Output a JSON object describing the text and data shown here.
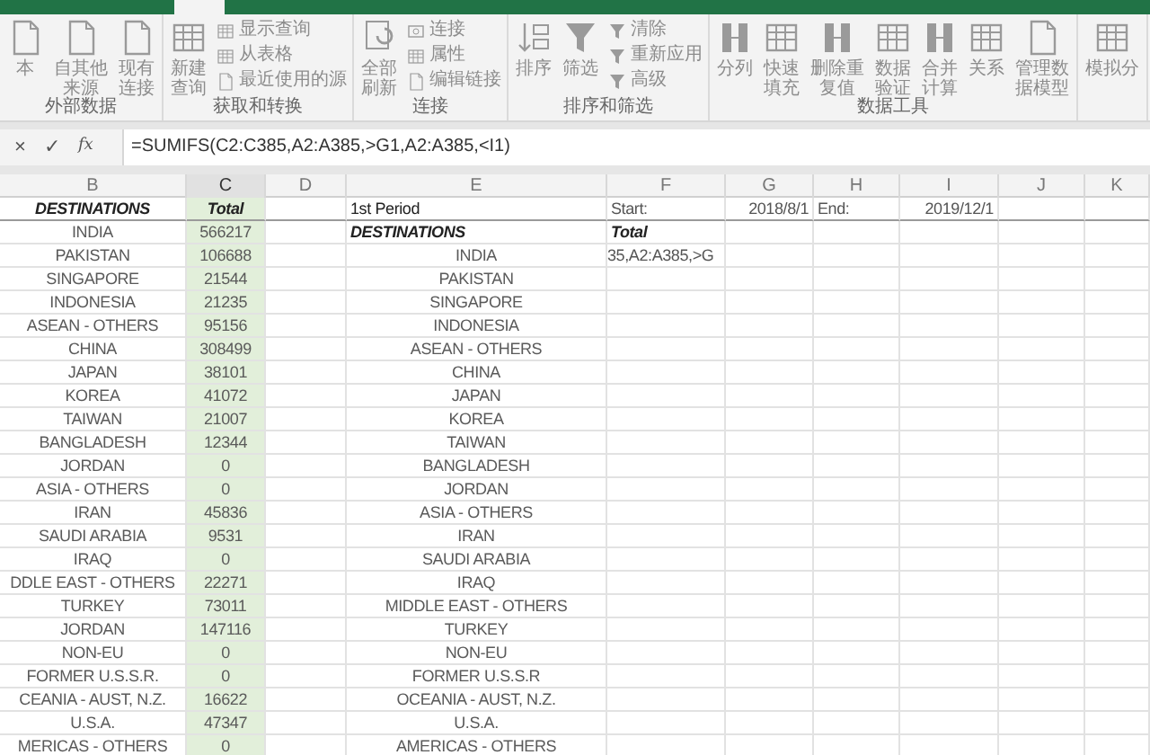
{
  "ribbon": {
    "groups": [
      {
        "label": "外部数据",
        "buttons": [
          {
            "label": "本",
            "kind": "large"
          },
          {
            "label": "自其他来源",
            "kind": "large"
          },
          {
            "label": "现有连接",
            "kind": "large"
          }
        ]
      },
      {
        "label": "获取和转换",
        "buttons": [
          {
            "label": "新建查询",
            "kind": "large"
          },
          {
            "label": "显示查询",
            "kind": "small"
          },
          {
            "label": "从表格",
            "kind": "small"
          },
          {
            "label": "最近使用的源",
            "kind": "small"
          }
        ]
      },
      {
        "label": "连接",
        "buttons": [
          {
            "label": "全部刷新",
            "kind": "large"
          },
          {
            "label": "连接",
            "kind": "small"
          },
          {
            "label": "属性",
            "kind": "small"
          },
          {
            "label": "编辑链接",
            "kind": "small"
          }
        ]
      },
      {
        "label": "排序和筛选",
        "buttons": [
          {
            "label": "排序",
            "kind": "large"
          },
          {
            "label": "筛选",
            "kind": "large"
          },
          {
            "label": "清除",
            "kind": "small"
          },
          {
            "label": "重新应用",
            "kind": "small"
          },
          {
            "label": "高级",
            "kind": "small"
          }
        ]
      },
      {
        "label": "数据工具",
        "buttons": [
          {
            "label": "分列",
            "kind": "large"
          },
          {
            "label": "快速填充",
            "kind": "large"
          },
          {
            "label": "删除重复值",
            "kind": "large"
          },
          {
            "label": "数据验证",
            "kind": "large"
          },
          {
            "label": "合并计算",
            "kind": "large"
          },
          {
            "label": "关系",
            "kind": "large"
          },
          {
            "label": "管理数据模型",
            "kind": "large"
          }
        ]
      },
      {
        "buttons": [
          {
            "label": "模拟分",
            "kind": "large"
          }
        ]
      }
    ]
  },
  "formula_bar": {
    "cancel": "×",
    "enter": "✓",
    "function": "fx",
    "formula": "=SUMIFS(C2:C385,A2:A385,>G1,A2:A385,<I1)"
  },
  "columns": [
    {
      "label": "B",
      "selected": false
    },
    {
      "label": "C",
      "selected": true
    },
    {
      "label": "D",
      "selected": false
    },
    {
      "label": "E",
      "selected": false
    },
    {
      "label": "F",
      "selected": false
    },
    {
      "label": "G",
      "selected": false
    },
    {
      "label": "H",
      "selected": false
    },
    {
      "label": "I",
      "selected": false
    },
    {
      "label": "J",
      "selected": false
    },
    {
      "label": "K",
      "selected": false
    }
  ],
  "rows": [
    {
      "B": {
        "text": "DESTINATIONS",
        "kind": "heading"
      },
      "C": {
        "text": "Total",
        "kind": "heading"
      },
      "E": {
        "text": "1st Period",
        "kind": "title"
      },
      "F": {
        "text": "Start:",
        "kind": "label"
      },
      "G": {
        "text": "2018/8/1",
        "kind": "date"
      },
      "H": {
        "text": "End:",
        "kind": "label"
      },
      "I": {
        "text": "2019/12/1",
        "kind": "date"
      }
    },
    {
      "B": {
        "text": "INDIA",
        "kind": "text"
      },
      "C": {
        "text": "566217",
        "kind": "text"
      },
      "E": {
        "text": "DESTINATIONS",
        "kind": "subheading"
      },
      "F": {
        "text": "Total",
        "kind": "subheading"
      }
    },
    {
      "B": {
        "text": "PAKISTAN",
        "kind": "text"
      },
      "C": {
        "text": "106688",
        "kind": "text"
      },
      "E": {
        "text": "INDIA",
        "kind": "text"
      },
      "F": {
        "text": "35,A2:A385,>G",
        "kind": "formula"
      }
    },
    {
      "B": {
        "text": "SINGAPORE",
        "kind": "text"
      },
      "C": {
        "text": "21544",
        "kind": "text"
      },
      "E": {
        "text": "PAKISTAN",
        "kind": "text"
      }
    },
    {
      "B": {
        "text": "INDONESIA",
        "kind": "text"
      },
      "C": {
        "text": "21235",
        "kind": "text"
      },
      "E": {
        "text": "SINGAPORE",
        "kind": "text"
      }
    },
    {
      "B": {
        "text": "ASEAN - OTHERS",
        "kind": "text"
      },
      "C": {
        "text": "95156",
        "kind": "text"
      },
      "E": {
        "text": "INDONESIA",
        "kind": "text"
      }
    },
    {
      "B": {
        "text": "CHINA",
        "kind": "text"
      },
      "C": {
        "text": "308499",
        "kind": "text"
      },
      "E": {
        "text": "ASEAN - OTHERS",
        "kind": "text"
      }
    },
    {
      "B": {
        "text": "JAPAN",
        "kind": "text"
      },
      "C": {
        "text": "38101",
        "kind": "text"
      },
      "E": {
        "text": "CHINA",
        "kind": "text"
      }
    },
    {
      "B": {
        "text": "KOREA",
        "kind": "text"
      },
      "C": {
        "text": "41072",
        "kind": "text"
      },
      "E": {
        "text": "JAPAN",
        "kind": "text"
      }
    },
    {
      "B": {
        "text": "TAIWAN",
        "kind": "text"
      },
      "C": {
        "text": "21007",
        "kind": "text"
      },
      "E": {
        "text": "KOREA",
        "kind": "text"
      }
    },
    {
      "B": {
        "text": "BANGLADESH",
        "kind": "text"
      },
      "C": {
        "text": "12344",
        "kind": "text"
      },
      "E": {
        "text": "TAIWAN",
        "kind": "text"
      }
    },
    {
      "B": {
        "text": "JORDAN",
        "kind": "text"
      },
      "C": {
        "text": "0",
        "kind": "text"
      },
      "E": {
        "text": "BANGLADESH",
        "kind": "text"
      }
    },
    {
      "B": {
        "text": "ASIA - OTHERS",
        "kind": "text"
      },
      "C": {
        "text": "0",
        "kind": "text"
      },
      "E": {
        "text": "JORDAN",
        "kind": "text"
      }
    },
    {
      "B": {
        "text": "IRAN",
        "kind": "text"
      },
      "C": {
        "text": "45836",
        "kind": "text"
      },
      "E": {
        "text": "ASIA - OTHERS",
        "kind": "text"
      }
    },
    {
      "B": {
        "text": "SAUDI ARABIA",
        "kind": "text"
      },
      "C": {
        "text": "9531",
        "kind": "text"
      },
      "E": {
        "text": "IRAN",
        "kind": "text"
      }
    },
    {
      "B": {
        "text": "IRAQ",
        "kind": "text"
      },
      "C": {
        "text": "0",
        "kind": "text"
      },
      "E": {
        "text": "SAUDI ARABIA",
        "kind": "text"
      }
    },
    {
      "B": {
        "text": "DDLE EAST - OTHERS",
        "kind": "text"
      },
      "C": {
        "text": "22271",
        "kind": "text"
      },
      "E": {
        "text": "IRAQ",
        "kind": "text"
      }
    },
    {
      "B": {
        "text": "TURKEY",
        "kind": "text"
      },
      "C": {
        "text": "73011",
        "kind": "text"
      },
      "E": {
        "text": "MIDDLE EAST - OTHERS",
        "kind": "text"
      }
    },
    {
      "B": {
        "text": "JORDAN",
        "kind": "text"
      },
      "C": {
        "text": "147116",
        "kind": "text"
      },
      "E": {
        "text": "TURKEY",
        "kind": "text"
      }
    },
    {
      "B": {
        "text": "NON-EU",
        "kind": "text"
      },
      "C": {
        "text": "0",
        "kind": "text"
      },
      "E": {
        "text": "NON-EU",
        "kind": "text"
      }
    },
    {
      "B": {
        "text": "FORMER U.S.S.R.",
        "kind": "text"
      },
      "C": {
        "text": "0",
        "kind": "text"
      },
      "E": {
        "text": "FORMER U.S.S.R",
        "kind": "text"
      }
    },
    {
      "B": {
        "text": "CEANIA - AUST, N.Z.",
        "kind": "text"
      },
      "C": {
        "text": "16622",
        "kind": "text"
      },
      "E": {
        "text": "OCEANIA - AUST, N.Z.",
        "kind": "text"
      }
    },
    {
      "B": {
        "text": "U.S.A.",
        "kind": "text"
      },
      "C": {
        "text": "47347",
        "kind": "text"
      },
      "E": {
        "text": "U.S.A.",
        "kind": "text"
      }
    },
    {
      "B": {
        "text": "MERICAS - OTHERS",
        "kind": "text"
      },
      "C": {
        "text": "0",
        "kind": "text"
      },
      "E": {
        "text": "AMERICAS - OTHERS",
        "kind": "text"
      }
    }
  ]
}
